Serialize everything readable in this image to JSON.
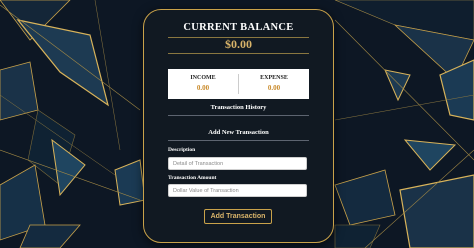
{
  "colors": {
    "accent": "#c9a24a",
    "background": "#0f1b2a",
    "card": "#111922",
    "balance_text": "#d9b46a"
  },
  "header": {
    "title": "CURRENT BALANCE",
    "balance": "$0.00"
  },
  "summary": {
    "income_label": "INCOME",
    "income_value": "0.00",
    "expense_label": "EXPENSE",
    "expense_value": "0.00"
  },
  "history": {
    "heading": "Transaction History"
  },
  "form": {
    "heading": "Add New Transaction",
    "description_label": "Description",
    "description_placeholder": "Detail of Transaction",
    "amount_label": "Transaction Amount",
    "amount_placeholder": "Dollar Value of Transaction",
    "submit_label": "Add Transaction"
  }
}
